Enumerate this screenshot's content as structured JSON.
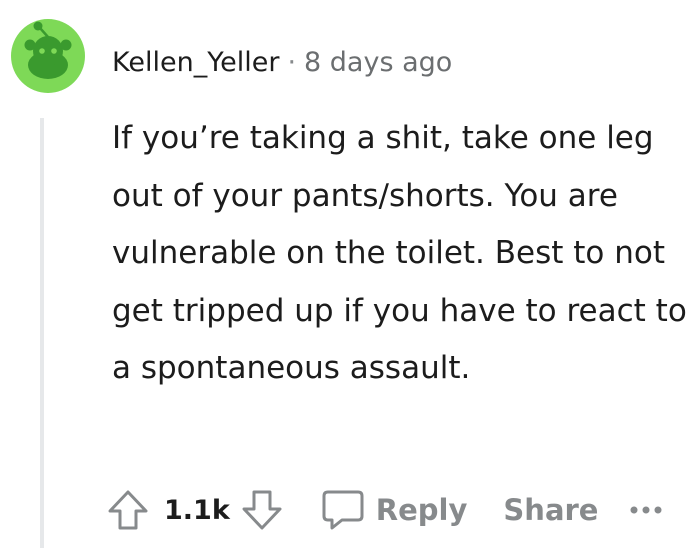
{
  "comment": {
    "username": "Kellen_Yeller",
    "separator": "·",
    "timestamp": "8 days ago",
    "body": "If you’re taking a shit, take one leg out of your pants/shorts. You are vulnerable on the toilet. Best to not get tripped up if you have to react to a spontaneous assault.",
    "score": "1.1k",
    "reply_label": "Reply",
    "share_label": "Share"
  },
  "icons": {
    "avatar": "reddit-snoo-avatar-icon",
    "upvote": "upvote-arrow-icon",
    "downvote": "downvote-arrow-icon",
    "reply": "speech-bubble-icon",
    "more": "ellipsis-icon"
  },
  "colors": {
    "avatar_bg": "#7ed957",
    "avatar_figure": "#3a9a2e",
    "thread_line": "#e6e8ea",
    "meta_gray": "#878a8c",
    "text": "#1c1c1c"
  }
}
